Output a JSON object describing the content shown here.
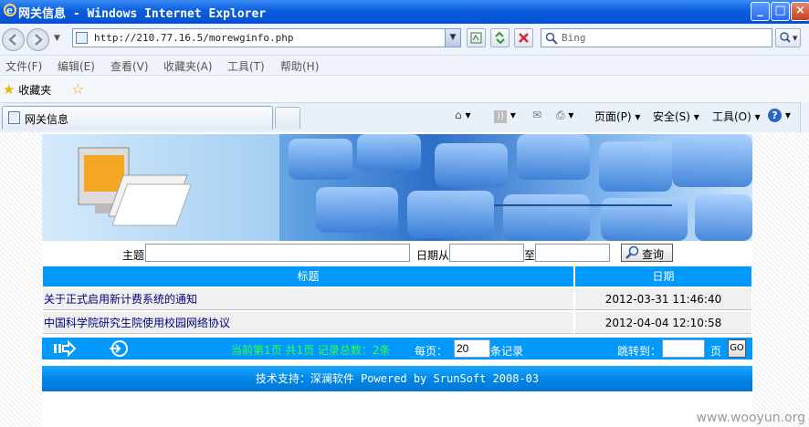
{
  "window": {
    "title": "网关信息 - Windows Internet Explorer"
  },
  "address": {
    "url": "http://210.77.16.5/morewginfo.php"
  },
  "search": {
    "placeholder": "Bing"
  },
  "menu": [
    "文件(F)",
    "编辑(E)",
    "查看(V)",
    "收藏夹(A)",
    "工具(T)",
    "帮助(H)"
  ],
  "favorites": {
    "label": "收藏夹"
  },
  "tab": {
    "label": "网关信息"
  },
  "commandbar": {
    "page": "页面(P)",
    "safety": "安全(S)",
    "tools": "工具(O)"
  },
  "filter": {
    "subject_label": "主题",
    "subject_value": "",
    "date_from_label": "日期从",
    "date_from_value": "",
    "date_to_label": "至",
    "date_to_value": "",
    "query_button": "查询"
  },
  "table": {
    "headers": [
      "标题",
      "日期"
    ],
    "rows": [
      {
        "title": "关于正式启用新计费系统的通知",
        "date": "2012-03-31 11:46:40"
      },
      {
        "title": "中国科学院研究生院使用校园网络协议",
        "date": "2012-04-04 12:10:58"
      }
    ]
  },
  "pager": {
    "status": "当前第1页 共1页 记录总数：2条",
    "per_page_label": "每页：",
    "per_page_value": "20",
    "per_page_suffix": "条记录",
    "jump_label": "跳转到：",
    "jump_value": "",
    "page_suffix": "页",
    "go_label": "GO"
  },
  "footer": {
    "text": "技术支持：深澜软件 Powered by SrunSoft 2008-03"
  },
  "watermark": "www.wooyun.org",
  "colors": {
    "title_bar": "#0a5ede",
    "grid_header": "#0099ff",
    "pager_status": "#3cff3c",
    "link": "#000080"
  }
}
